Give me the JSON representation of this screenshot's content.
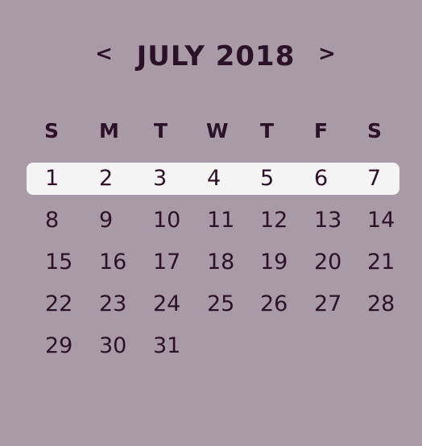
{
  "header": {
    "prev_label": "<",
    "title": "JULY 2018",
    "next_label": ">"
  },
  "weekdays": [
    "S",
    "M",
    "T",
    "W",
    "T",
    "F",
    "S"
  ],
  "weeks": [
    [
      "1",
      "2",
      "3",
      "4",
      "5",
      "6",
      "7"
    ],
    [
      "8",
      "9",
      "10",
      "11",
      "12",
      "13",
      "14"
    ],
    [
      "15",
      "16",
      "17",
      "18",
      "19",
      "20",
      "21"
    ],
    [
      "22",
      "23",
      "24",
      "25",
      "26",
      "27",
      "28"
    ],
    [
      "29",
      "30",
      "31"
    ]
  ],
  "highlighted_week_index": 0,
  "colors": {
    "background": "#a89aa7",
    "text": "#2c1229",
    "highlight": "#f5f4f4"
  }
}
